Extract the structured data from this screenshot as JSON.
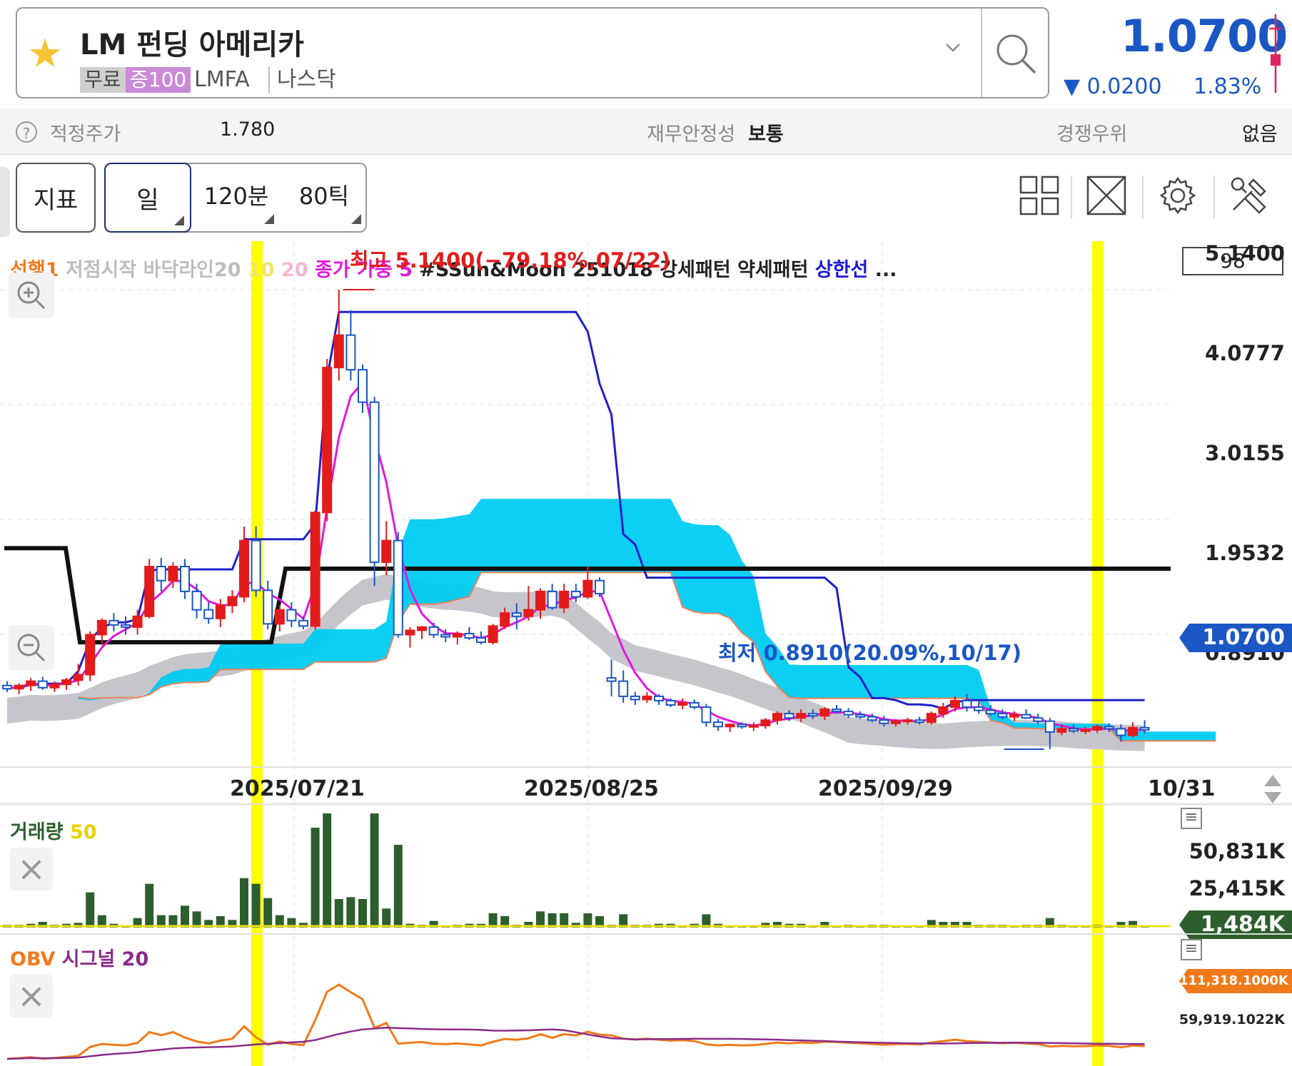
{
  "header": {
    "name": "LM 펀딩 아메리카",
    "tag_free": "무료",
    "tag_margin": "증100",
    "ticker": "LMFA",
    "market": "나스닥",
    "price": "1.0700",
    "change": "▼ 0.0200",
    "change_pct": "1.83%",
    "accent_color": "#1a56c4"
  },
  "info_row": {
    "fair_price_label": "적정주가",
    "fair_price_value": "1.780",
    "stability_label": "재무안정성",
    "stability_value": "보통",
    "competitive_label": "경쟁우위",
    "competitive_value": "없음"
  },
  "toolbar": {
    "indicator_label": "지표",
    "period_day": "일",
    "period_120m": "120분",
    "period_80tick": "80틱",
    "icons": [
      "grid-icon",
      "expand-icon",
      "gear-icon",
      "tools-icon"
    ]
  },
  "chart_legend": {
    "item1": "선행1",
    "item2": "저점시작 바닥라인20",
    "item3": "10",
    "item4": "20",
    "item5": "종가 가중 5",
    "item6": "#SSun&Moon 251018 강세패턴 약세패턴",
    "item7": "상한선",
    "item8": "...",
    "count_box": "98",
    "high_annotation": "최고 5.1400(−79.18%,07/22)",
    "low_annotation": "최저 0.8910(20.09%,10/17)",
    "current_price_tag": "1.0700"
  },
  "chart_data": {
    "type": "candlestick",
    "y_ticks": [
      "5.1400",
      "4.0777",
      "3.0155",
      "1.9532",
      "0.8910"
    ],
    "ylim": [
      0.891,
      5.14
    ],
    "x_ticks": [
      "2025/07/21",
      "2025/08/25",
      "2025/09/29",
      "10/31"
    ],
    "high": 5.14,
    "low": 0.891,
    "last": 1.07,
    "candles": [
      [
        1.48,
        1.52,
        1.42,
        1.45
      ],
      [
        1.45,
        1.5,
        1.4,
        1.48
      ],
      [
        1.48,
        1.55,
        1.43,
        1.52
      ],
      [
        1.52,
        1.56,
        1.44,
        1.46
      ],
      [
        1.46,
        1.52,
        1.42,
        1.49
      ],
      [
        1.49,
        1.55,
        1.44,
        1.53
      ],
      [
        1.53,
        1.68,
        1.48,
        1.58
      ],
      [
        1.58,
        1.98,
        1.52,
        1.95
      ],
      [
        1.95,
        2.1,
        1.85,
        2.08
      ],
      [
        2.08,
        2.15,
        1.98,
        2.04
      ],
      [
        2.04,
        2.12,
        1.95,
        2.02
      ],
      [
        2.02,
        2.18,
        1.95,
        2.12
      ],
      [
        2.12,
        2.65,
        2.1,
        2.58
      ],
      [
        2.58,
        2.66,
        2.35,
        2.45
      ],
      [
        2.45,
        2.62,
        2.38,
        2.58
      ],
      [
        2.58,
        2.65,
        2.28,
        2.35
      ],
      [
        2.35,
        2.42,
        2.1,
        2.18
      ],
      [
        2.18,
        2.25,
        2.05,
        2.1
      ],
      [
        2.1,
        2.28,
        2.02,
        2.22
      ],
      [
        2.22,
        2.36,
        2.15,
        2.3
      ],
      [
        2.3,
        2.95,
        2.25,
        2.82
      ],
      [
        2.82,
        2.95,
        2.3,
        2.36
      ],
      [
        2.36,
        2.45,
        2.0,
        2.05
      ],
      [
        2.05,
        2.22,
        1.98,
        2.18
      ],
      [
        2.18,
        2.25,
        2.02,
        2.08
      ],
      [
        2.08,
        2.12,
        2.0,
        2.03
      ],
      [
        2.03,
        3.1,
        2.0,
        3.08
      ],
      [
        3.08,
        4.5,
        3.0,
        4.42
      ],
      [
        4.42,
        5.14,
        4.3,
        4.72
      ],
      [
        4.72,
        4.95,
        4.3,
        4.4
      ],
      [
        4.4,
        4.45,
        4.0,
        4.1
      ],
      [
        4.1,
        4.15,
        2.4,
        2.62
      ],
      [
        2.62,
        3.0,
        2.5,
        2.82
      ],
      [
        2.82,
        2.9,
        1.92,
        1.95
      ],
      [
        1.95,
        2.02,
        1.83,
        1.99
      ],
      [
        1.99,
        2.03,
        1.91,
        2.02
      ],
      [
        2.02,
        2.06,
        1.92,
        1.95
      ],
      [
        1.95,
        2.0,
        1.88,
        1.93
      ],
      [
        1.93,
        1.98,
        1.86,
        1.96
      ],
      [
        1.96,
        2.02,
        1.9,
        1.92
      ],
      [
        1.92,
        1.98,
        1.86,
        1.88
      ],
      [
        1.88,
        2.05,
        1.86,
        2.03
      ],
      [
        2.03,
        2.2,
        2.0,
        2.15
      ],
      [
        2.15,
        2.24,
        2.0,
        2.12
      ],
      [
        2.12,
        2.4,
        2.08,
        2.18
      ],
      [
        2.18,
        2.38,
        2.1,
        2.35
      ],
      [
        2.35,
        2.42,
        2.18,
        2.2
      ],
      [
        2.2,
        2.42,
        2.15,
        2.35
      ],
      [
        2.35,
        2.42,
        2.25,
        2.3
      ],
      [
        2.3,
        2.58,
        2.28,
        2.45
      ],
      [
        2.45,
        2.48,
        2.3,
        2.33
      ],
      [
        1.55,
        1.72,
        1.38,
        1.52
      ],
      [
        1.52,
        1.62,
        1.32,
        1.38
      ],
      [
        1.38,
        1.42,
        1.3,
        1.35
      ],
      [
        1.35,
        1.42,
        1.32,
        1.38
      ],
      [
        1.38,
        1.4,
        1.3,
        1.34
      ],
      [
        1.34,
        1.36,
        1.28,
        1.3
      ],
      [
        1.3,
        1.36,
        1.26,
        1.32
      ],
      [
        1.32,
        1.35,
        1.26,
        1.28
      ],
      [
        1.28,
        1.31,
        1.1,
        1.14
      ],
      [
        1.14,
        1.17,
        1.06,
        1.1
      ],
      [
        1.1,
        1.13,
        1.05,
        1.12
      ],
      [
        1.12,
        1.14,
        1.08,
        1.1
      ],
      [
        1.1,
        1.14,
        1.06,
        1.11
      ],
      [
        1.11,
        1.18,
        1.08,
        1.16
      ],
      [
        1.16,
        1.24,
        1.12,
        1.22
      ],
      [
        1.22,
        1.25,
        1.15,
        1.18
      ],
      [
        1.18,
        1.26,
        1.14,
        1.22
      ],
      [
        1.22,
        1.26,
        1.17,
        1.2
      ],
      [
        1.2,
        1.28,
        1.16,
        1.26
      ],
      [
        1.26,
        1.3,
        1.22,
        1.24
      ],
      [
        1.24,
        1.27,
        1.18,
        1.21
      ],
      [
        1.21,
        1.24,
        1.17,
        1.19
      ],
      [
        1.19,
        1.22,
        1.14,
        1.16
      ],
      [
        1.16,
        1.2,
        1.1,
        1.13
      ],
      [
        1.13,
        1.17,
        1.1,
        1.15
      ],
      [
        1.15,
        1.18,
        1.12,
        1.16
      ],
      [
        1.16,
        1.19,
        1.12,
        1.14
      ],
      [
        1.14,
        1.24,
        1.12,
        1.22
      ],
      [
        1.22,
        1.32,
        1.18,
        1.28
      ],
      [
        1.28,
        1.38,
        1.24,
        1.34
      ],
      [
        1.34,
        1.4,
        1.24,
        1.28
      ],
      [
        1.28,
        1.33,
        1.22,
        1.25
      ],
      [
        1.25,
        1.3,
        1.2,
        1.22
      ],
      [
        1.22,
        1.26,
        1.17,
        1.19
      ],
      [
        1.19,
        1.24,
        1.15,
        1.21
      ],
      [
        1.21,
        1.26,
        1.17,
        1.18
      ],
      [
        1.18,
        1.22,
        1.12,
        1.15
      ],
      [
        1.15,
        1.18,
        0.891,
        1.05
      ],
      [
        1.05,
        1.12,
        1.02,
        1.08
      ],
      [
        1.08,
        1.12,
        1.04,
        1.06
      ],
      [
        1.06,
        1.1,
        1.03,
        1.07
      ],
      [
        1.07,
        1.12,
        1.04,
        1.1
      ],
      [
        1.1,
        1.13,
        1.05,
        1.08
      ],
      [
        1.08,
        1.12,
        0.96,
        1.02
      ],
      [
        1.02,
        1.14,
        1.0,
        1.09
      ],
      [
        1.09,
        1.16,
        1.04,
        1.07
      ]
    ],
    "volume": {
      "title": "거래량",
      "period": "50",
      "ticks": [
        "50,831K",
        "25,415K"
      ],
      "last_tag": "1,484K"
    },
    "obv": {
      "title": "OBV",
      "signal": "시그널 20",
      "last_tag": "111,318.1000K",
      "secondary": "59,919.1022K"
    }
  }
}
